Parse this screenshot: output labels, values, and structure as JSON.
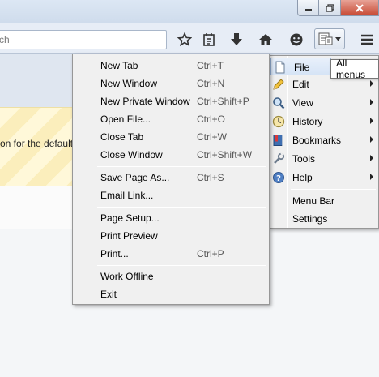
{
  "search": {
    "placeholder": "rch"
  },
  "notice": {
    "text": "on for the default"
  },
  "toolbar": {
    "icons": [
      "star-icon",
      "reading-list-icon",
      "download-icon",
      "home-icon",
      "smiley-icon",
      "all-menus-icon",
      "hamburger-menu-icon"
    ]
  },
  "tooltip": {
    "label": "All menus"
  },
  "file_menu": {
    "items": [
      {
        "label": "New Tab",
        "shortcut": "Ctrl+T"
      },
      {
        "label": "New Window",
        "shortcut": "Ctrl+N"
      },
      {
        "label": "New Private Window",
        "shortcut": "Ctrl+Shift+P"
      },
      {
        "label": "Open File...",
        "shortcut": "Ctrl+O"
      },
      {
        "label": "Close Tab",
        "shortcut": "Ctrl+W"
      },
      {
        "label": "Close Window",
        "shortcut": "Ctrl+Shift+W"
      },
      {
        "label": "Save Page As...",
        "shortcut": "Ctrl+S"
      },
      {
        "label": "Email Link...",
        "shortcut": ""
      },
      {
        "label": "Page Setup...",
        "shortcut": ""
      },
      {
        "label": "Print Preview",
        "shortcut": ""
      },
      {
        "label": "Print...",
        "shortcut": "Ctrl+P"
      },
      {
        "label": "Work Offline",
        "shortcut": ""
      },
      {
        "label": "Exit",
        "shortcut": ""
      }
    ]
  },
  "all_menus": {
    "items": [
      {
        "label": "File",
        "icon": "file-icon"
      },
      {
        "label": "Edit",
        "icon": "pencil-icon"
      },
      {
        "label": "View",
        "icon": "magnifier-icon"
      },
      {
        "label": "History",
        "icon": "clock-icon"
      },
      {
        "label": "Bookmarks",
        "icon": "bookmarks-icon"
      },
      {
        "label": "Tools",
        "icon": "tools-icon"
      },
      {
        "label": "Help",
        "icon": "help-icon"
      },
      {
        "label": "Menu Bar",
        "icon": ""
      },
      {
        "label": "Settings",
        "icon": ""
      }
    ]
  }
}
